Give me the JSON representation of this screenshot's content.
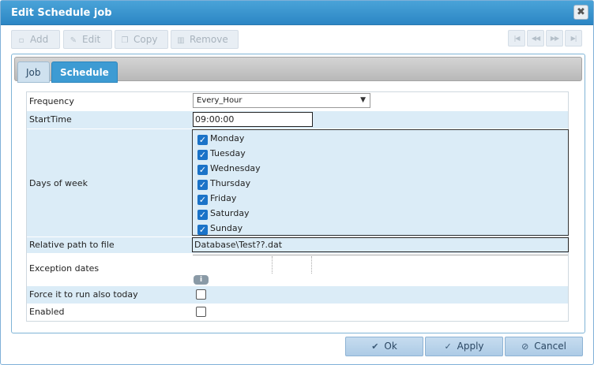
{
  "dialog": {
    "title": "Edit Schedule job",
    "close_glyph": "✖",
    "toolbar": {
      "add": "Add",
      "edit": "Edit",
      "copy": "Copy",
      "remove": "Remove"
    },
    "tabs": [
      "Job",
      "Schedule"
    ],
    "active_tab": "Schedule"
  },
  "form": {
    "frequency_label": "Frequency",
    "frequency_value": "Every_Hour",
    "starttime_label": "StartTime",
    "starttime_value": "09:00:00",
    "days_label": "Days of week",
    "days": [
      "Monday",
      "Tuesday",
      "Wednesday",
      "Thursday",
      "Friday",
      "Saturday",
      "Sunday"
    ],
    "path_label": "Relative path to file",
    "path_value": "Database\\Test??.dat",
    "exception_label": "Exception dates",
    "force_label": "Force it to run also today",
    "enabled_label": "Enabled"
  },
  "buttons": {
    "ok": "Ok",
    "apply": "Apply",
    "cancel": "Cancel"
  },
  "icons": {
    "add": "add-icon",
    "edit": "pencil-icon",
    "copy": "copy-icon",
    "remove": "trash-icon",
    "ok": "check-circle-icon",
    "apply": "checkmark-icon",
    "cancel": "cancel-circle-icon",
    "info": "info-icon"
  },
  "colors": {
    "title_bar": "#2c86c4",
    "active_tab": "#3d9bd3",
    "alt_row": "#dbecf7",
    "checkbox": "#1b73c8"
  }
}
